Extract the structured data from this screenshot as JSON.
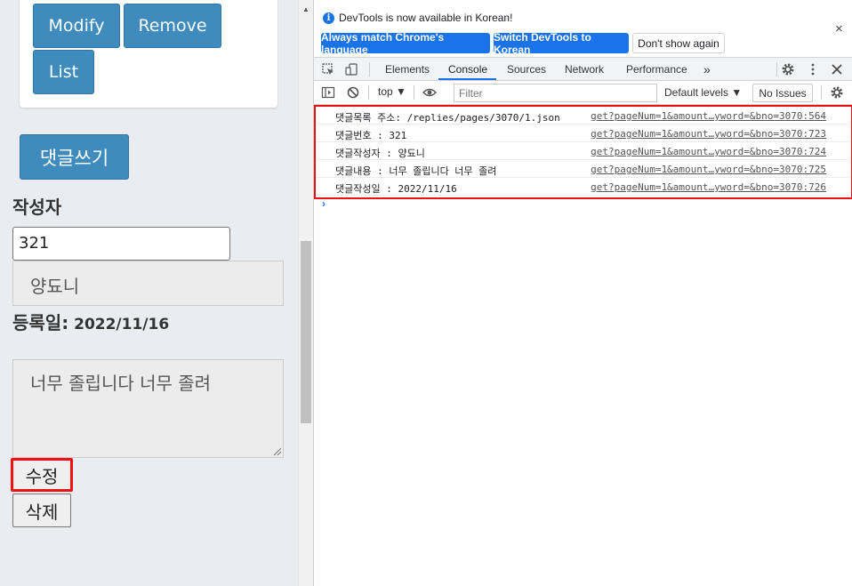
{
  "page": {
    "buttons": {
      "modify": "Modify",
      "remove": "Remove",
      "list": "List",
      "write_reply": "댓글쓰기"
    },
    "form": {
      "writer_label": "작성자",
      "reply_no_value": "321",
      "replyer_value": "양됴니",
      "regdate_label": "등록일:",
      "regdate_value": " 2022/11/16",
      "content_value": "너무 졸립니다 너무 졸려",
      "edit_label": "수정",
      "delete_label": "삭제"
    }
  },
  "devtools": {
    "infobar": {
      "message": "DevTools is now available in Korean!",
      "btn_match": "Always match Chrome's language",
      "btn_switch": "Switch DevTools to Korean",
      "btn_dont_show": "Don't show again",
      "close": "×"
    },
    "tabs": [
      {
        "label": "Elements"
      },
      {
        "label": "Console"
      },
      {
        "label": "Sources"
      },
      {
        "label": "Network"
      },
      {
        "label": "Performance"
      },
      {
        "label": "»"
      }
    ],
    "toolbar": {
      "context": "top ▼",
      "filter_placeholder": "Filter",
      "levels": "Default levels ▼",
      "no_issues": "No Issues"
    },
    "logs": [
      {
        "message": "댓글목록 주소: /replies/pages/3070/1.json",
        "source": "get?pageNum=1&amount…yword=&bno=3070:564"
      },
      {
        "message": "댓글번호 : 321",
        "source": "get?pageNum=1&amount…yword=&bno=3070:723"
      },
      {
        "message": "댓글작성자 : 양됴니",
        "source": "get?pageNum=1&amount…yword=&bno=3070:724"
      },
      {
        "message": "댓글내용 : 너무 졸립니다 너무 졸려",
        "source": "get?pageNum=1&amount…yword=&bno=3070:725"
      },
      {
        "message": "댓글작성일 : 2022/11/16",
        "source": "get?pageNum=1&amount…yword=&bno=3070:726"
      }
    ],
    "prompt": "›"
  },
  "colors": {
    "primary_button": "#3f8bbd",
    "devtools_blue": "#1a73e8",
    "highlight_red": "#ee1111"
  }
}
